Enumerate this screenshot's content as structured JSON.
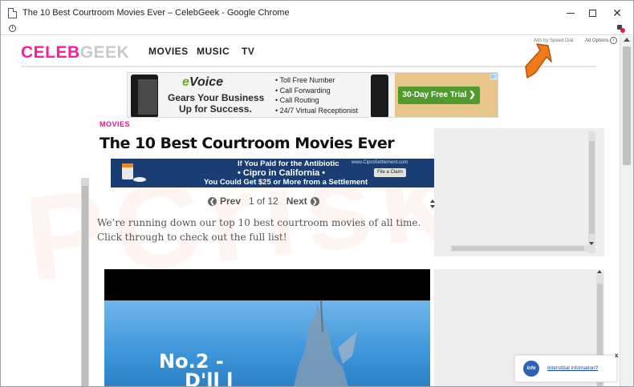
{
  "window": {
    "title": "The 10 Best Courtroom Movies Ever – CelebGeek - Google Chrome",
    "controls": {
      "minimize": "–",
      "maximize": "□",
      "close": "✕"
    }
  },
  "address_bar": {
    "info_icon": "i"
  },
  "site": {
    "logo_part1": "CELEB",
    "logo_part2": "GEEK",
    "nav": [
      "MOVIES",
      "MUSIC",
      "TV"
    ],
    "ads_by": "Ads by Speed Dial",
    "ad_options": "Ad Options",
    "ad_options_icon": "i"
  },
  "banner_ad": {
    "brand_prefix": "e",
    "brand_rest": "Voice",
    "line1": "Gears Your Business",
    "line2": "Up for Success.",
    "features": [
      "Toll Free Number",
      "Call Forwarding",
      "Call Routing",
      "24/7 Virtual Receptionist"
    ],
    "cta": "30-Day Free Trial ❯"
  },
  "article": {
    "category": "MOVIES",
    "title": "The 10 Best Courtroom Movies Ever",
    "intro": "We’re running down our top 10 best courtroom movies of all time. Click through to check out the full list!",
    "feature_text_line1": "No.2 -",
    "feature_text_line2": "D'll l"
  },
  "cipro_ad": {
    "line1": "If You Paid for the Antibiotic",
    "line2": "• Cipro in California •",
    "line3": "You Could Get $25 or More from a Settlement",
    "site": "www.CiproSettlement.com",
    "button": "File a Claim"
  },
  "pager": {
    "prev_icon": "❮",
    "prev": "Prev",
    "status": "1 of 12",
    "next": "Next",
    "next_icon": "❯"
  },
  "info_popup": {
    "badge": "Info",
    "link": "Interstitial infomation?",
    "close": "x"
  },
  "colors": {
    "logo_pink": "#ff1aa3",
    "category_pink": "#e0148a",
    "arrow_orange": "#f07a1a",
    "cta_green": "#4f9b2c",
    "cipro_blue": "#1a3d73"
  }
}
